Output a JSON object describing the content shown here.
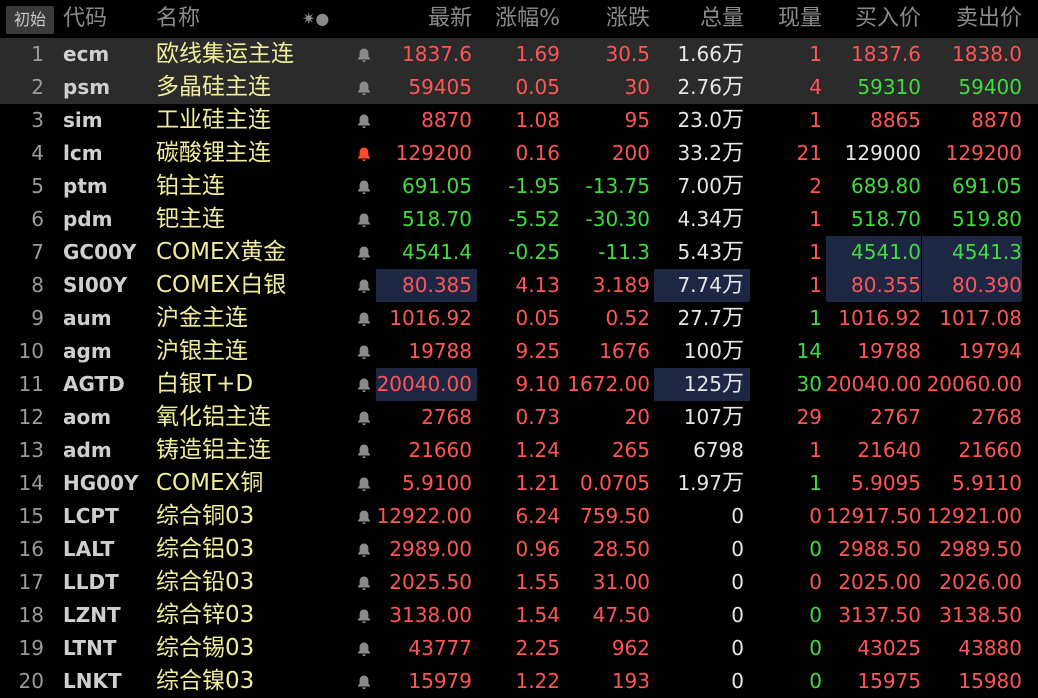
{
  "header": {
    "reset": "初始",
    "code": "代码",
    "name": "名称",
    "star": "✷●",
    "last": "最新",
    "pct": "涨幅%",
    "chg": "涨跌",
    "vol": "总量",
    "cur": "现量",
    "bid": "买入价",
    "ask": "卖出价"
  },
  "colors": {
    "up": "#ff5555",
    "down": "#3fdc3f",
    "neutral": "#e6e6e6",
    "name": "#f0ee9a",
    "alert": "#ff4a2a",
    "highlight": "#1d2744"
  },
  "rows": [
    {
      "idx": "1",
      "code": "ecm",
      "name": "欧线集运主连",
      "last": "1837.6",
      "pct": "1.69",
      "chg": "30.5",
      "vol": "1.66",
      "volUnit": "万",
      "cur": "1",
      "bid": "1837.6",
      "ask": "1838.0",
      "dir": "up",
      "curDir": "up",
      "bidDir": "up",
      "askDir": "up",
      "icon": "bell-icon"
    },
    {
      "idx": "2",
      "code": "psm",
      "name": "多晶硅主连",
      "last": "59405",
      "pct": "0.05",
      "chg": "30",
      "vol": "2.76",
      "volUnit": "万",
      "cur": "4",
      "bid": "59310",
      "ask": "59400",
      "dir": "up",
      "curDir": "up",
      "bidDir": "dn",
      "askDir": "dn",
      "icon": "bell-icon"
    },
    {
      "idx": "3",
      "code": "sim",
      "name": "工业硅主连",
      "last": "8870",
      "pct": "1.08",
      "chg": "95",
      "vol": "23.0",
      "volUnit": "万",
      "cur": "1",
      "bid": "8865",
      "ask": "8870",
      "dir": "up",
      "curDir": "up",
      "bidDir": "up",
      "askDir": "up",
      "icon": "bell-icon"
    },
    {
      "idx": "4",
      "code": "lcm",
      "name": "碳酸锂主连",
      "last": "129200",
      "pct": "0.16",
      "chg": "200",
      "vol": "33.2",
      "volUnit": "万",
      "cur": "21",
      "bid": "129000",
      "ask": "129200",
      "dir": "up",
      "curDir": "up",
      "bidDir": "wt",
      "askDir": "up",
      "icon": "bell-alert-icon"
    },
    {
      "idx": "5",
      "code": "ptm",
      "name": "铂主连",
      "last": "691.05",
      "pct": "-1.95",
      "chg": "-13.75",
      "vol": "7.00",
      "volUnit": "万",
      "cur": "2",
      "bid": "689.80",
      "ask": "691.05",
      "dir": "dn",
      "curDir": "up",
      "bidDir": "dn",
      "askDir": "dn",
      "icon": "bell-icon"
    },
    {
      "idx": "6",
      "code": "pdm",
      "name": "钯主连",
      "last": "518.70",
      "pct": "-5.52",
      "chg": "-30.30",
      "vol": "4.34",
      "volUnit": "万",
      "cur": "1",
      "bid": "518.70",
      "ask": "519.80",
      "dir": "dn",
      "curDir": "up",
      "bidDir": "dn",
      "askDir": "dn",
      "icon": "bell-icon"
    },
    {
      "idx": "7",
      "code": "GC00Y",
      "name": "COMEX黄金",
      "last": "4541.4",
      "pct": "-0.25",
      "chg": "-11.3",
      "vol": "5.43",
      "volUnit": "万",
      "cur": "1",
      "bid": "4541.0",
      "ask": "4541.3",
      "dir": "dn",
      "curDir": "up",
      "bidDir": "dn",
      "askDir": "dn",
      "icon": "bell-icon"
    },
    {
      "idx": "8",
      "code": "SI00Y",
      "name": "COMEX白银",
      "last": "80.385",
      "pct": "4.13",
      "chg": "3.189",
      "vol": "7.74",
      "volUnit": "万",
      "cur": "1",
      "bid": "80.355",
      "ask": "80.390",
      "dir": "up",
      "curDir": "up",
      "bidDir": "up",
      "askDir": "up",
      "icon": "bell-icon"
    },
    {
      "idx": "9",
      "code": "aum",
      "name": "沪金主连",
      "last": "1016.92",
      "pct": "0.05",
      "chg": "0.52",
      "vol": "27.7",
      "volUnit": "万",
      "cur": "1",
      "bid": "1016.92",
      "ask": "1017.08",
      "dir": "up",
      "curDir": "dn",
      "bidDir": "up",
      "askDir": "up",
      "icon": "bell-icon"
    },
    {
      "idx": "10",
      "code": "agm",
      "name": "沪银主连",
      "last": "19788",
      "pct": "9.25",
      "chg": "1676",
      "vol": "100",
      "volUnit": "万",
      "cur": "14",
      "bid": "19788",
      "ask": "19794",
      "dir": "up",
      "curDir": "dn",
      "bidDir": "up",
      "askDir": "up",
      "icon": "bell-icon"
    },
    {
      "idx": "11",
      "code": "AGTD",
      "name": "白银T+D",
      "last": "20040.00",
      "pct": "9.10",
      "chg": "1672.00",
      "vol": "125",
      "volUnit": "万",
      "cur": "30",
      "bid": "20040.00",
      "ask": "20060.00",
      "dir": "up",
      "curDir": "dn",
      "bidDir": "up",
      "askDir": "up",
      "icon": "bell-icon"
    },
    {
      "idx": "12",
      "code": "aom",
      "name": "氧化铝主连",
      "last": "2768",
      "pct": "0.73",
      "chg": "20",
      "vol": "107",
      "volUnit": "万",
      "cur": "29",
      "bid": "2767",
      "ask": "2768",
      "dir": "up",
      "curDir": "up",
      "bidDir": "up",
      "askDir": "up",
      "icon": "bell-icon"
    },
    {
      "idx": "13",
      "code": "adm",
      "name": "铸造铝主连",
      "last": "21660",
      "pct": "1.24",
      "chg": "265",
      "vol": "6798",
      "volUnit": "",
      "cur": "1",
      "bid": "21640",
      "ask": "21660",
      "dir": "up",
      "curDir": "up",
      "bidDir": "up",
      "askDir": "up",
      "icon": "bell-icon"
    },
    {
      "idx": "14",
      "code": "HG00Y",
      "name": "COMEX铜",
      "last": "5.9100",
      "pct": "1.21",
      "chg": "0.0705",
      "vol": "1.97",
      "volUnit": "万",
      "cur": "1",
      "bid": "5.9095",
      "ask": "5.9110",
      "dir": "up",
      "curDir": "dn",
      "bidDir": "up",
      "askDir": "up",
      "icon": "bell-icon"
    },
    {
      "idx": "15",
      "code": "LCPT",
      "name": "综合铜03",
      "last": "12922.00",
      "pct": "6.24",
      "chg": "759.50",
      "vol": "0",
      "volUnit": "",
      "cur": "0",
      "bid": "12917.50",
      "ask": "12921.00",
      "dir": "up",
      "curDir": "up",
      "bidDir": "up",
      "askDir": "up",
      "icon": "bell-icon"
    },
    {
      "idx": "16",
      "code": "LALT",
      "name": "综合铝03",
      "last": "2989.00",
      "pct": "0.96",
      "chg": "28.50",
      "vol": "0",
      "volUnit": "",
      "cur": "0",
      "bid": "2988.50",
      "ask": "2989.50",
      "dir": "up",
      "curDir": "dn",
      "bidDir": "up",
      "askDir": "up",
      "icon": "bell-icon"
    },
    {
      "idx": "17",
      "code": "LLDT",
      "name": "综合铅03",
      "last": "2025.50",
      "pct": "1.55",
      "chg": "31.00",
      "vol": "0",
      "volUnit": "",
      "cur": "0",
      "bid": "2025.00",
      "ask": "2026.00",
      "dir": "up",
      "curDir": "up",
      "bidDir": "up",
      "askDir": "up",
      "icon": "bell-icon"
    },
    {
      "idx": "18",
      "code": "LZNT",
      "name": "综合锌03",
      "last": "3138.00",
      "pct": "1.54",
      "chg": "47.50",
      "vol": "0",
      "volUnit": "",
      "cur": "0",
      "bid": "3137.50",
      "ask": "3138.50",
      "dir": "up",
      "curDir": "dn",
      "bidDir": "up",
      "askDir": "up",
      "icon": "bell-icon"
    },
    {
      "idx": "19",
      "code": "LTNT",
      "name": "综合锡03",
      "last": "43777",
      "pct": "2.25",
      "chg": "962",
      "vol": "0",
      "volUnit": "",
      "cur": "0",
      "bid": "43025",
      "ask": "43880",
      "dir": "up",
      "curDir": "dn",
      "bidDir": "up",
      "askDir": "up",
      "icon": "bell-icon"
    },
    {
      "idx": "20",
      "code": "LNKT",
      "name": "综合镍03",
      "last": "15979",
      "pct": "1.22",
      "chg": "193",
      "vol": "0",
      "volUnit": "",
      "cur": "0",
      "bid": "15975",
      "ask": "15980",
      "dir": "up",
      "curDir": "dn",
      "bidDir": "up",
      "askDir": "up",
      "icon": "bell-icon"
    }
  ]
}
